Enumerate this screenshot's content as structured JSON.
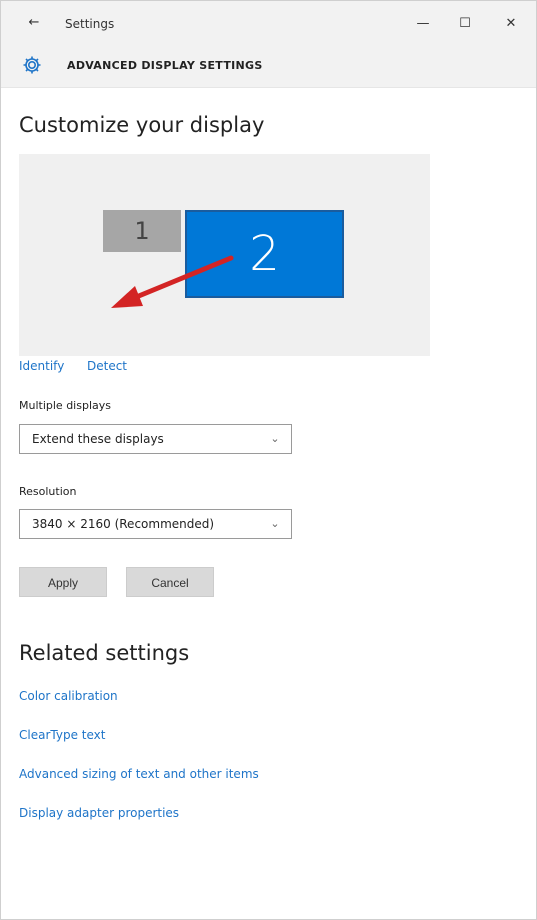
{
  "window": {
    "title": "Settings",
    "back_glyph": "←",
    "minimize_glyph": "—",
    "maximize_glyph": "☐",
    "close_glyph": "✕"
  },
  "header": {
    "icon": "gear-icon",
    "title": "ADVANCED DISPLAY SETTINGS"
  },
  "customize": {
    "title": "Customize your display",
    "monitors": [
      {
        "label": "1"
      },
      {
        "label": "2",
        "selected": true
      }
    ],
    "identify_label": "Identify",
    "detect_label": "Detect"
  },
  "multiple_displays": {
    "label": "Multiple displays",
    "value": "Extend these displays"
  },
  "resolution": {
    "label": "Resolution",
    "value": "3840 × 2160 (Recommended)"
  },
  "buttons": {
    "apply_label": "Apply",
    "cancel_label": "Cancel"
  },
  "related": {
    "title": "Related settings",
    "links": [
      {
        "label": "Color calibration"
      },
      {
        "label": "ClearType text"
      },
      {
        "label": "Advanced sizing of text and other items"
      },
      {
        "label": "Display adapter properties"
      }
    ]
  },
  "colors": {
    "accent": "#0078d7",
    "link": "#1e74c8",
    "arrow": "#d32424",
    "monitor_inactive": "#a6a6a6"
  }
}
